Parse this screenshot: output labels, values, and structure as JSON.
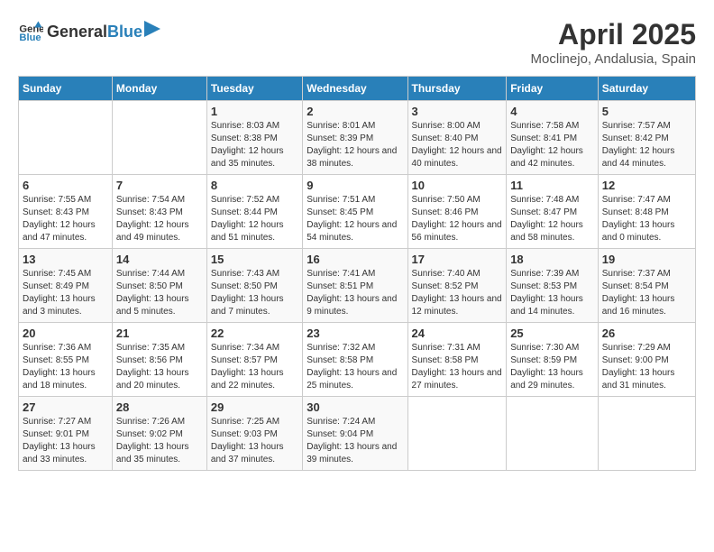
{
  "logo": {
    "text_general": "General",
    "text_blue": "Blue"
  },
  "header": {
    "title": "April 2025",
    "subtitle": "Moclinejo, Andalusia, Spain"
  },
  "days_of_week": [
    "Sunday",
    "Monday",
    "Tuesday",
    "Wednesday",
    "Thursday",
    "Friday",
    "Saturday"
  ],
  "weeks": [
    [
      {
        "day": "",
        "info": ""
      },
      {
        "day": "",
        "info": ""
      },
      {
        "day": "1",
        "sunrise": "Sunrise: 8:03 AM",
        "sunset": "Sunset: 8:38 PM",
        "daylight": "Daylight: 12 hours and 35 minutes."
      },
      {
        "day": "2",
        "sunrise": "Sunrise: 8:01 AM",
        "sunset": "Sunset: 8:39 PM",
        "daylight": "Daylight: 12 hours and 38 minutes."
      },
      {
        "day": "3",
        "sunrise": "Sunrise: 8:00 AM",
        "sunset": "Sunset: 8:40 PM",
        "daylight": "Daylight: 12 hours and 40 minutes."
      },
      {
        "day": "4",
        "sunrise": "Sunrise: 7:58 AM",
        "sunset": "Sunset: 8:41 PM",
        "daylight": "Daylight: 12 hours and 42 minutes."
      },
      {
        "day": "5",
        "sunrise": "Sunrise: 7:57 AM",
        "sunset": "Sunset: 8:42 PM",
        "daylight": "Daylight: 12 hours and 44 minutes."
      }
    ],
    [
      {
        "day": "6",
        "sunrise": "Sunrise: 7:55 AM",
        "sunset": "Sunset: 8:43 PM",
        "daylight": "Daylight: 12 hours and 47 minutes."
      },
      {
        "day": "7",
        "sunrise": "Sunrise: 7:54 AM",
        "sunset": "Sunset: 8:43 PM",
        "daylight": "Daylight: 12 hours and 49 minutes."
      },
      {
        "day": "8",
        "sunrise": "Sunrise: 7:52 AM",
        "sunset": "Sunset: 8:44 PM",
        "daylight": "Daylight: 12 hours and 51 minutes."
      },
      {
        "day": "9",
        "sunrise": "Sunrise: 7:51 AM",
        "sunset": "Sunset: 8:45 PM",
        "daylight": "Daylight: 12 hours and 54 minutes."
      },
      {
        "day": "10",
        "sunrise": "Sunrise: 7:50 AM",
        "sunset": "Sunset: 8:46 PM",
        "daylight": "Daylight: 12 hours and 56 minutes."
      },
      {
        "day": "11",
        "sunrise": "Sunrise: 7:48 AM",
        "sunset": "Sunset: 8:47 PM",
        "daylight": "Daylight: 12 hours and 58 minutes."
      },
      {
        "day": "12",
        "sunrise": "Sunrise: 7:47 AM",
        "sunset": "Sunset: 8:48 PM",
        "daylight": "Daylight: 13 hours and 0 minutes."
      }
    ],
    [
      {
        "day": "13",
        "sunrise": "Sunrise: 7:45 AM",
        "sunset": "Sunset: 8:49 PM",
        "daylight": "Daylight: 13 hours and 3 minutes."
      },
      {
        "day": "14",
        "sunrise": "Sunrise: 7:44 AM",
        "sunset": "Sunset: 8:50 PM",
        "daylight": "Daylight: 13 hours and 5 minutes."
      },
      {
        "day": "15",
        "sunrise": "Sunrise: 7:43 AM",
        "sunset": "Sunset: 8:50 PM",
        "daylight": "Daylight: 13 hours and 7 minutes."
      },
      {
        "day": "16",
        "sunrise": "Sunrise: 7:41 AM",
        "sunset": "Sunset: 8:51 PM",
        "daylight": "Daylight: 13 hours and 9 minutes."
      },
      {
        "day": "17",
        "sunrise": "Sunrise: 7:40 AM",
        "sunset": "Sunset: 8:52 PM",
        "daylight": "Daylight: 13 hours and 12 minutes."
      },
      {
        "day": "18",
        "sunrise": "Sunrise: 7:39 AM",
        "sunset": "Sunset: 8:53 PM",
        "daylight": "Daylight: 13 hours and 14 minutes."
      },
      {
        "day": "19",
        "sunrise": "Sunrise: 7:37 AM",
        "sunset": "Sunset: 8:54 PM",
        "daylight": "Daylight: 13 hours and 16 minutes."
      }
    ],
    [
      {
        "day": "20",
        "sunrise": "Sunrise: 7:36 AM",
        "sunset": "Sunset: 8:55 PM",
        "daylight": "Daylight: 13 hours and 18 minutes."
      },
      {
        "day": "21",
        "sunrise": "Sunrise: 7:35 AM",
        "sunset": "Sunset: 8:56 PM",
        "daylight": "Daylight: 13 hours and 20 minutes."
      },
      {
        "day": "22",
        "sunrise": "Sunrise: 7:34 AM",
        "sunset": "Sunset: 8:57 PM",
        "daylight": "Daylight: 13 hours and 22 minutes."
      },
      {
        "day": "23",
        "sunrise": "Sunrise: 7:32 AM",
        "sunset": "Sunset: 8:58 PM",
        "daylight": "Daylight: 13 hours and 25 minutes."
      },
      {
        "day": "24",
        "sunrise": "Sunrise: 7:31 AM",
        "sunset": "Sunset: 8:58 PM",
        "daylight": "Daylight: 13 hours and 27 minutes."
      },
      {
        "day": "25",
        "sunrise": "Sunrise: 7:30 AM",
        "sunset": "Sunset: 8:59 PM",
        "daylight": "Daylight: 13 hours and 29 minutes."
      },
      {
        "day": "26",
        "sunrise": "Sunrise: 7:29 AM",
        "sunset": "Sunset: 9:00 PM",
        "daylight": "Daylight: 13 hours and 31 minutes."
      }
    ],
    [
      {
        "day": "27",
        "sunrise": "Sunrise: 7:27 AM",
        "sunset": "Sunset: 9:01 PM",
        "daylight": "Daylight: 13 hours and 33 minutes."
      },
      {
        "day": "28",
        "sunrise": "Sunrise: 7:26 AM",
        "sunset": "Sunset: 9:02 PM",
        "daylight": "Daylight: 13 hours and 35 minutes."
      },
      {
        "day": "29",
        "sunrise": "Sunrise: 7:25 AM",
        "sunset": "Sunset: 9:03 PM",
        "daylight": "Daylight: 13 hours and 37 minutes."
      },
      {
        "day": "30",
        "sunrise": "Sunrise: 7:24 AM",
        "sunset": "Sunset: 9:04 PM",
        "daylight": "Daylight: 13 hours and 39 minutes."
      },
      {
        "day": "",
        "info": ""
      },
      {
        "day": "",
        "info": ""
      },
      {
        "day": "",
        "info": ""
      }
    ]
  ]
}
